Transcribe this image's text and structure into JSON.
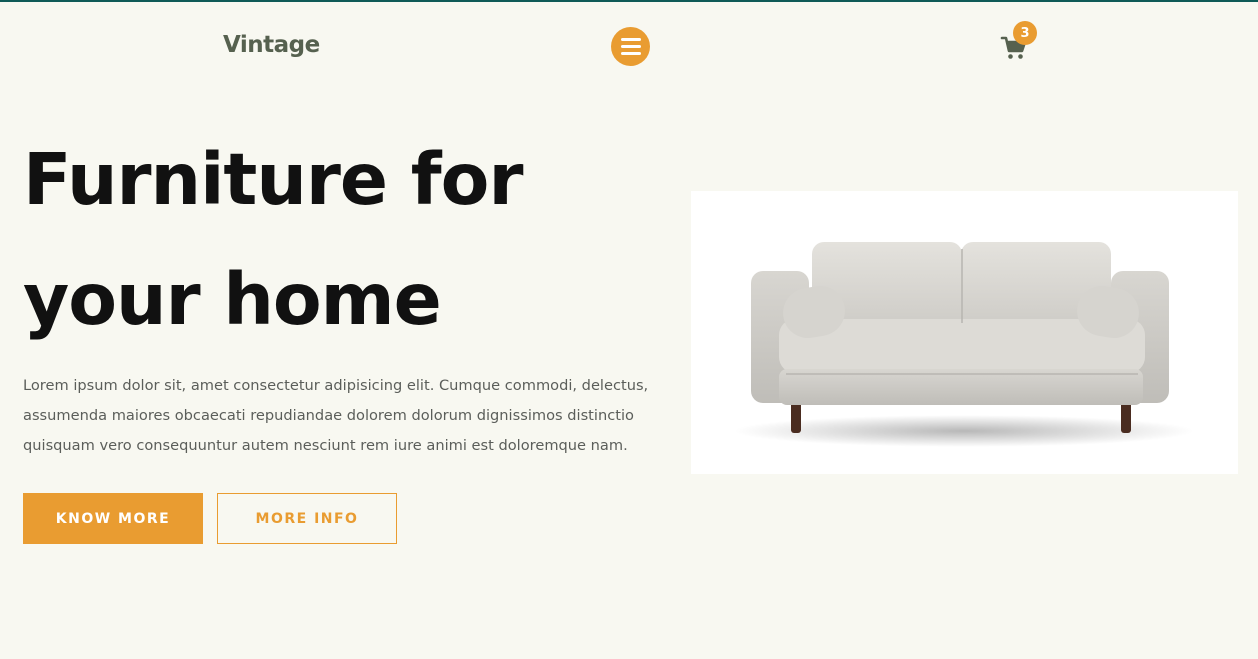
{
  "header": {
    "brand": "Vintage",
    "menu_icon": "hamburger-menu-icon",
    "cart_icon": "shopping-cart-icon",
    "cart_count": "3"
  },
  "hero": {
    "title": "Furniture for your home",
    "description": "Lorem ipsum dolor sit, amet consectetur adipisicing elit. Cumque commodi, delectus, assumenda maiores obcaecati repudiandae dolorem dolorum dignissimos distinctio quisquam vero consequuntur autem nesciunt rem iure animi est doloremque nam.",
    "primary_button": "KNOW MORE",
    "secondary_button": "MORE INFO",
    "image": "sofa-image"
  },
  "colors": {
    "accent": "#e99c31",
    "background": "#f8f8f1",
    "brand_text": "#56614f",
    "top_border": "#0f5a57"
  }
}
